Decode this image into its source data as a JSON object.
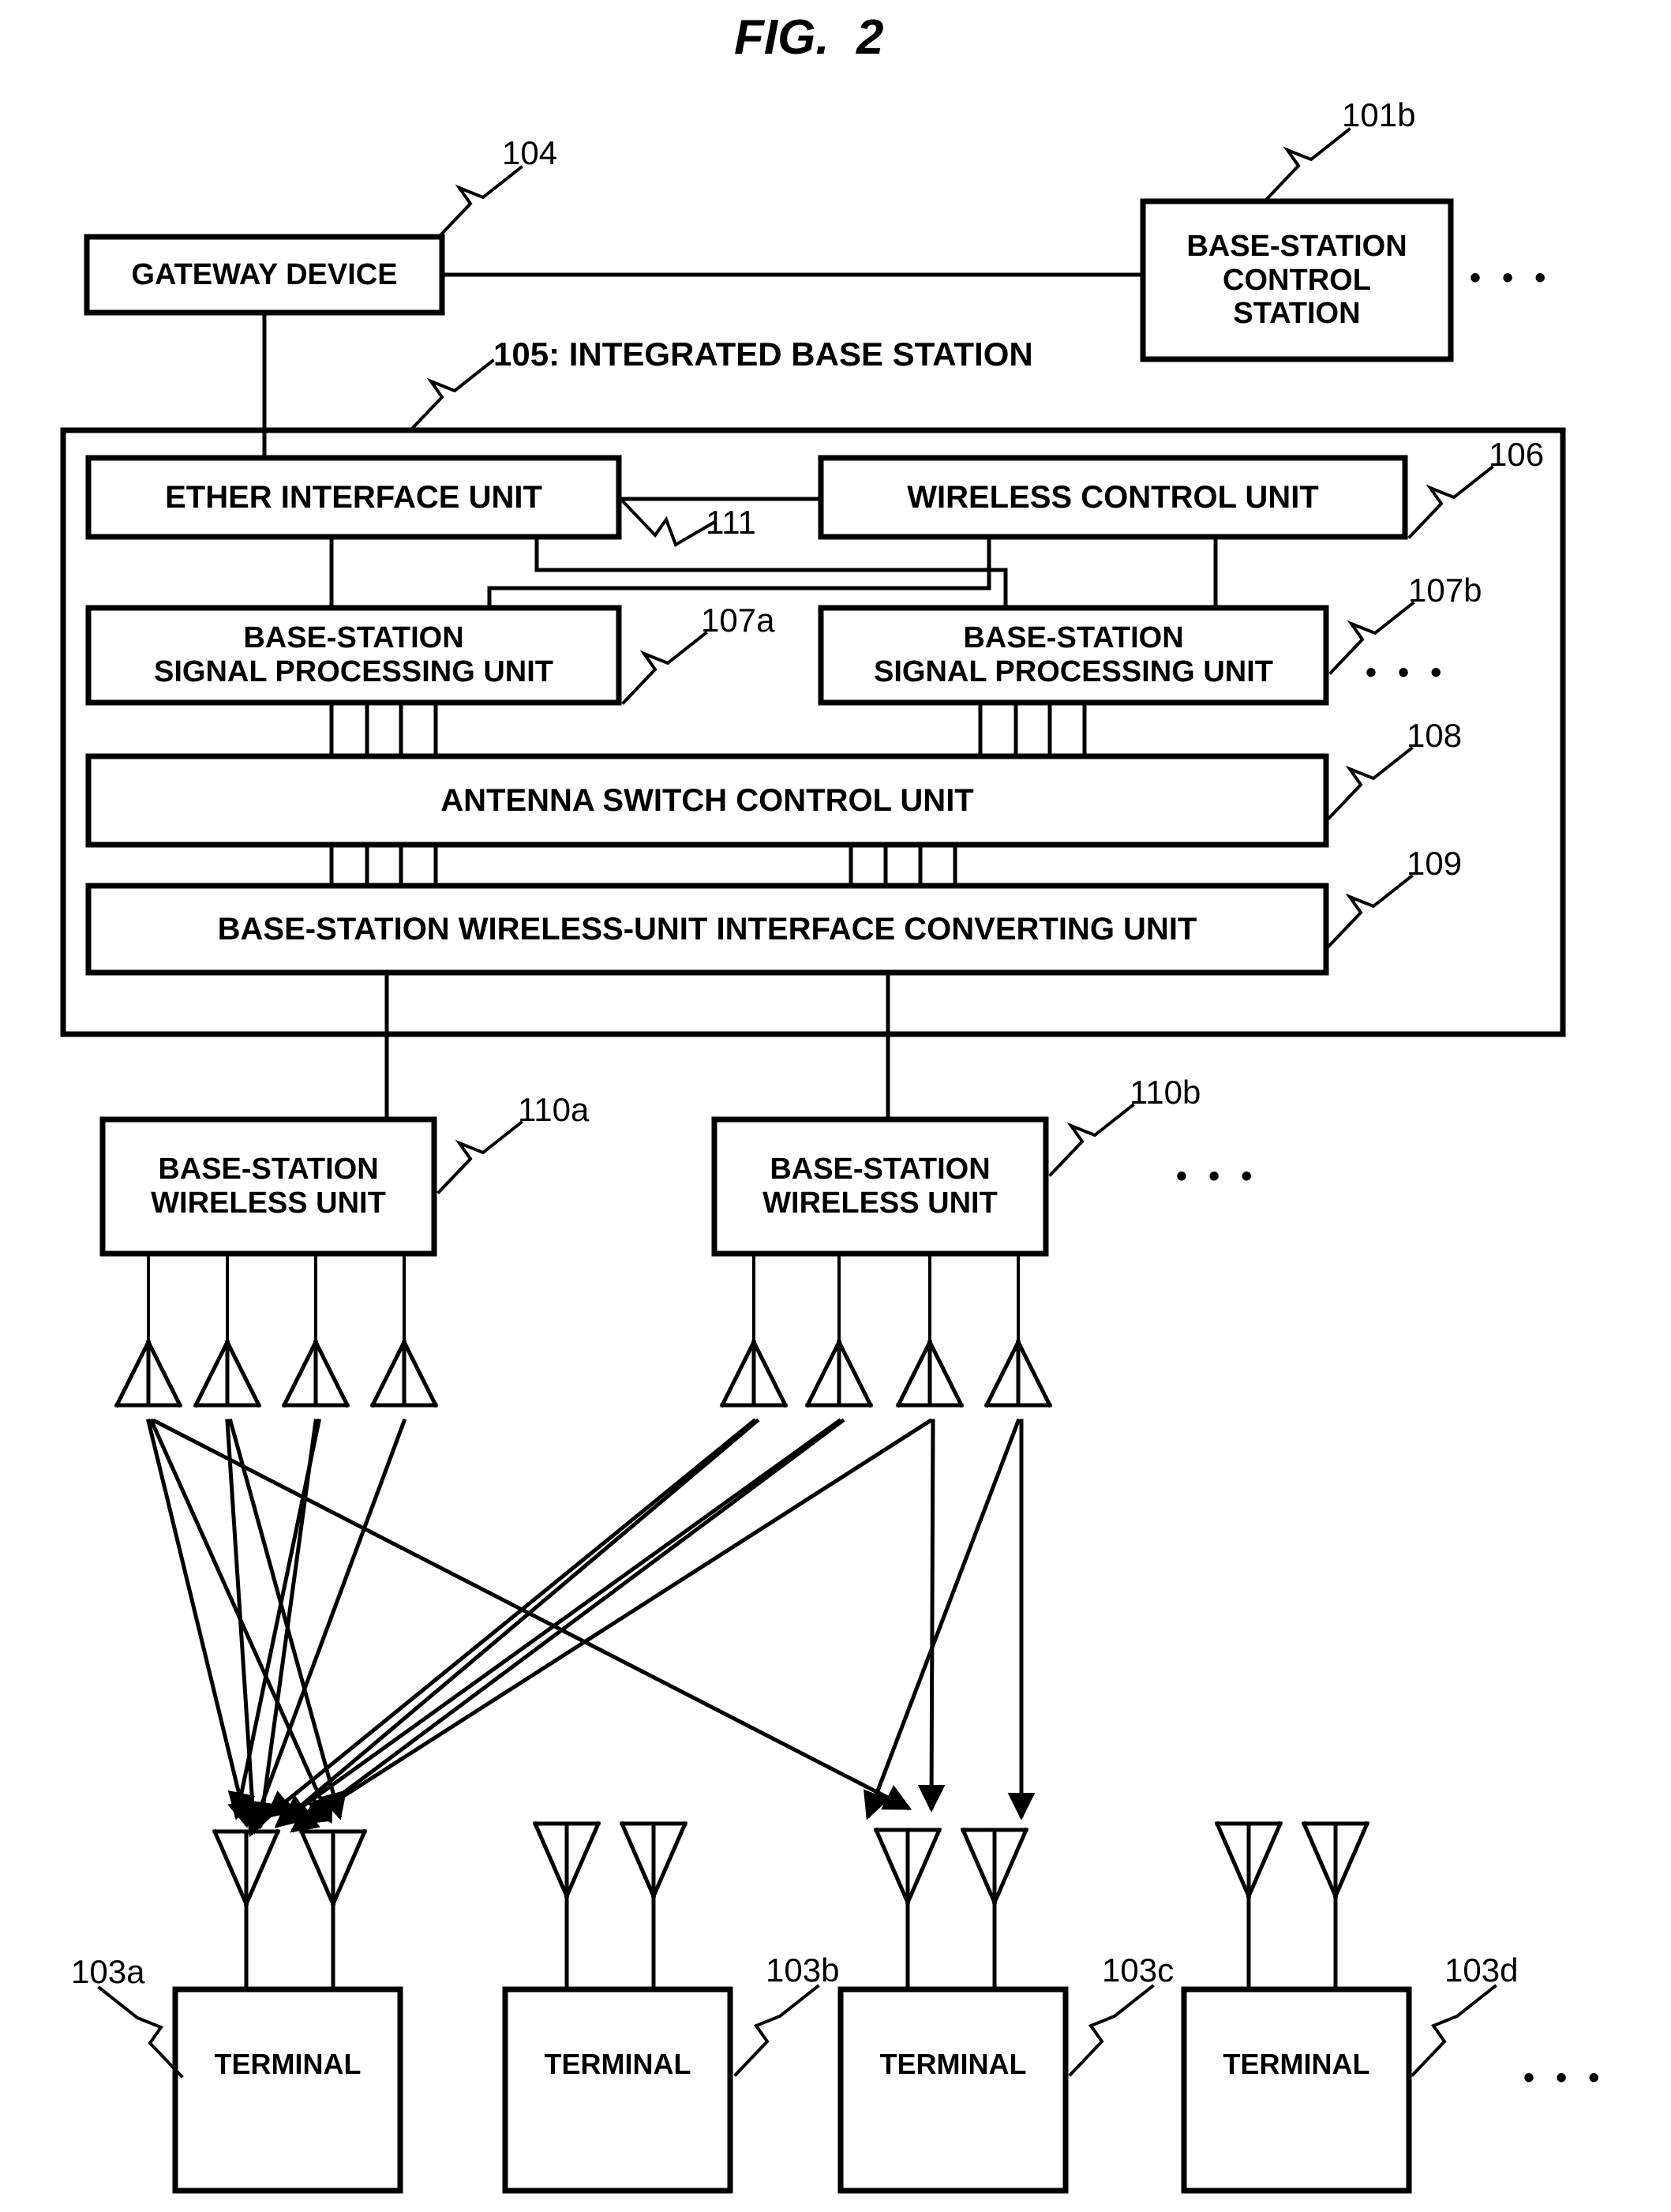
{
  "figure": {
    "title": "FIG.  2",
    "type": "patent-block-diagram"
  },
  "blocks": {
    "gateway_device": {
      "label": "GATEWAY DEVICE",
      "ref": "104"
    },
    "base_station_control_station": {
      "label": "BASE-STATION\nCONTROL\nSTATION",
      "ref": "101b"
    },
    "integrated_base_station": {
      "label": "105: INTEGRATED BASE STATION",
      "ref": "105"
    },
    "ether_interface_unit": {
      "label": "ETHER INTERFACE UNIT",
      "ref": "111"
    },
    "wireless_control_unit": {
      "label": "WIRELESS CONTROL UNIT",
      "ref": "106"
    },
    "base_station_signal_processing_unit_a": {
      "label": "BASE-STATION\nSIGNAL PROCESSING UNIT",
      "ref": "107a"
    },
    "base_station_signal_processing_unit_b": {
      "label": "BASE-STATION\nSIGNAL PROCESSING UNIT",
      "ref": "107b"
    },
    "antenna_switch_control_unit": {
      "label": "ANTENNA SWITCH CONTROL UNIT",
      "ref": "108"
    },
    "interface_converting_unit": {
      "label": "BASE-STATION WIRELESS-UNIT INTERFACE CONVERTING UNIT",
      "ref": "109"
    },
    "base_station_wireless_unit_a": {
      "label": "BASE-STATION\nWIRELESS UNIT",
      "ref": "110a"
    },
    "base_station_wireless_unit_b": {
      "label": "BASE-STATION\nWIRELESS UNIT",
      "ref": "110b"
    },
    "terminal_a": {
      "label": "TERMINAL",
      "ref": "103a"
    },
    "terminal_b": {
      "label": "TERMINAL",
      "ref": "103b"
    },
    "terminal_c": {
      "label": "TERMINAL",
      "ref": "103c"
    },
    "terminal_d": {
      "label": "TERMINAL",
      "ref": "103d"
    }
  },
  "ellipses": {
    "control_station_row": "• • •",
    "signal_processing_row": "• • •",
    "wireless_unit_row": "• • •",
    "terminal_row": "• • •"
  },
  "colors": {
    "stroke": "#000000",
    "background": "#ffffff"
  },
  "chart_data": {
    "type": "diagram",
    "title": "FIG.  2",
    "nodes": [
      {
        "id": "104",
        "label": "GATEWAY DEVICE"
      },
      {
        "id": "101b",
        "label": "BASE-STATION CONTROL STATION"
      },
      {
        "id": "105",
        "label": "INTEGRATED BASE STATION"
      },
      {
        "id": "111",
        "label": "ETHER INTERFACE UNIT link"
      },
      {
        "id": "106",
        "label": "WIRELESS CONTROL UNIT"
      },
      {
        "id": "107a",
        "label": "BASE-STATION SIGNAL PROCESSING UNIT"
      },
      {
        "id": "107b",
        "label": "BASE-STATION SIGNAL PROCESSING UNIT"
      },
      {
        "id": "108",
        "label": "ANTENNA SWITCH CONTROL UNIT"
      },
      {
        "id": "109",
        "label": "BASE-STATION WIRELESS-UNIT INTERFACE CONVERTING UNIT"
      },
      {
        "id": "110a",
        "label": "BASE-STATION WIRELESS UNIT"
      },
      {
        "id": "110b",
        "label": "BASE-STATION WIRELESS UNIT"
      },
      {
        "id": "103a",
        "label": "TERMINAL"
      },
      {
        "id": "103b",
        "label": "TERMINAL"
      },
      {
        "id": "103c",
        "label": "TERMINAL"
      },
      {
        "id": "103d",
        "label": "TERMINAL"
      }
    ],
    "edges": [
      {
        "from": "104",
        "to": "101b"
      },
      {
        "from": "104",
        "to": "ether-interface-unit"
      },
      {
        "from": "ether-interface-unit",
        "to": "106"
      },
      {
        "from": "ether-interface-unit",
        "to": "107a"
      },
      {
        "from": "ether-interface-unit",
        "to": "107b"
      },
      {
        "from": "106",
        "to": "107a"
      },
      {
        "from": "106",
        "to": "107b"
      },
      {
        "from": "107a",
        "to": "108"
      },
      {
        "from": "107b",
        "to": "108"
      },
      {
        "from": "108",
        "to": "109"
      },
      {
        "from": "109",
        "to": "110a"
      },
      {
        "from": "109",
        "to": "110b"
      },
      {
        "from": "110a",
        "to": "103a"
      },
      {
        "from": "110a",
        "to": "103c"
      },
      {
        "from": "110b",
        "to": "103a"
      },
      {
        "from": "110b",
        "to": "103c"
      }
    ]
  }
}
